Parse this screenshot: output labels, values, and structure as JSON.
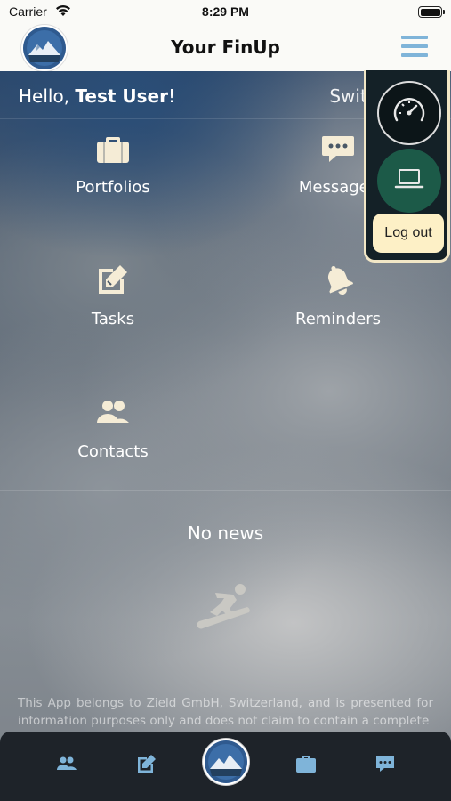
{
  "status_bar": {
    "carrier": "Carrier",
    "time": "8:29 PM"
  },
  "nav": {
    "title": "Your FinUp"
  },
  "greeting": {
    "prefix": "Hello, ",
    "name": "Test User",
    "suffix": "!",
    "country": "Switzerland"
  },
  "tiles": [
    {
      "label": "Portfolios",
      "icon": "briefcase-icon"
    },
    {
      "label": "Messages",
      "icon": "chat-icon"
    },
    {
      "label": "Tasks",
      "icon": "edit-icon"
    },
    {
      "label": "Reminders",
      "icon": "bell-icon"
    },
    {
      "label": "Contacts",
      "icon": "users-icon"
    }
  ],
  "news": {
    "empty_text": "No news"
  },
  "disclaimer": "This App belongs to Zield GmbH, Switzerland, and is presented for information purposes only and does not claim to contain a complete",
  "popup_menu": {
    "logout_label": "Log out"
  },
  "tab_bar": {
    "tabs": [
      "users-icon",
      "edit-icon",
      "avatar",
      "briefcase-icon",
      "chat-icon"
    ]
  },
  "colors": {
    "accent_blue": "#7fb4d9",
    "tile_icon": "#f5ecd6",
    "popup_bg": "#142127",
    "screen_btn": "#1c5a48",
    "logout_bg": "#fdf0c6"
  }
}
